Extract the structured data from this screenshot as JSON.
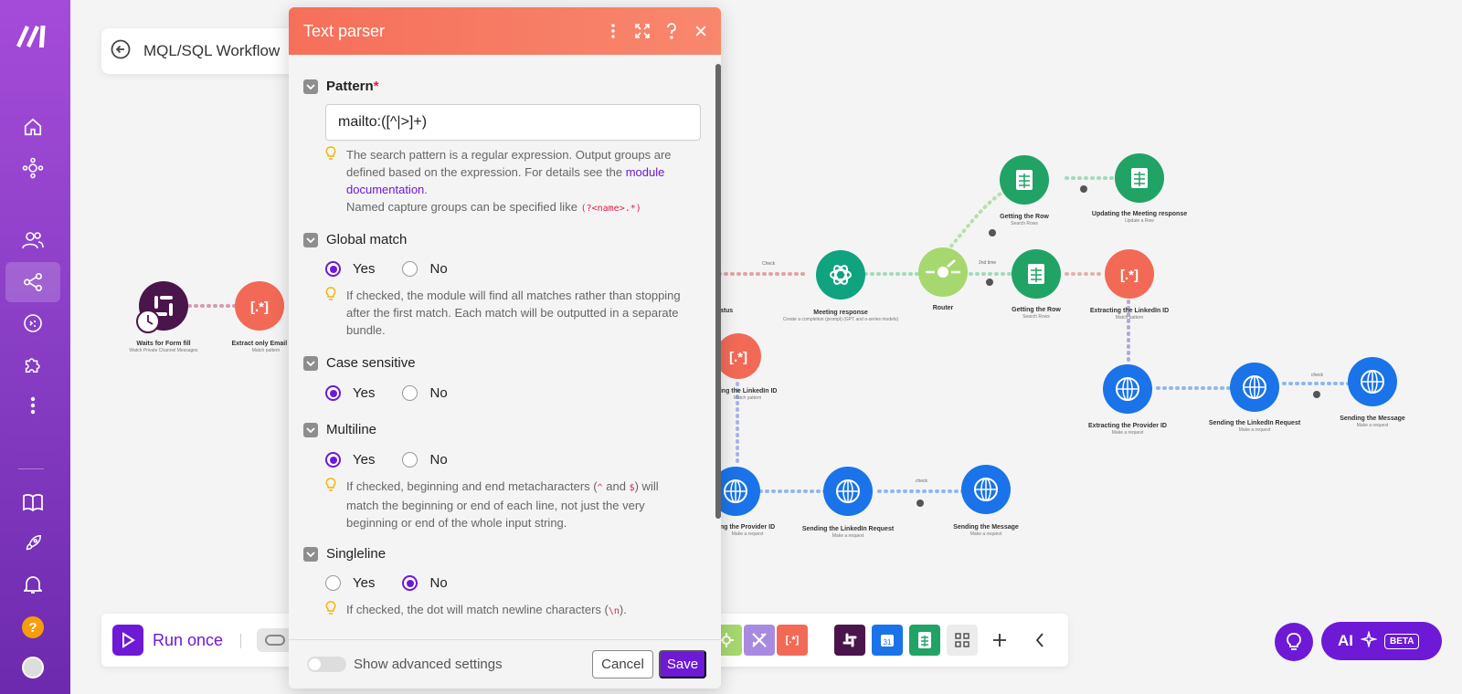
{
  "scenario": {
    "title": "MQL/SQL Workflow"
  },
  "flow_nodes": [
    {
      "id": "slack",
      "label": "Waits for Form fill",
      "sub": "Watch Private Channel Messages",
      "color": "#4a154b",
      "icon": "slack-icon"
    },
    {
      "id": "textparser1",
      "label": "Extract only Email add",
      "sub": "Match pattern",
      "color": "#f26a56",
      "icon": "text-parser-icon"
    },
    {
      "id": "status",
      "label": "atus",
      "sub": ""
    },
    {
      "id": "openai",
      "label": "Meeting response",
      "sub": "Create a completion (prompt) (GPT and o-series models)",
      "color": "#10a37f",
      "icon": "openai-icon"
    },
    {
      "id": "router",
      "label": "Router",
      "sub": "",
      "color": "#a6d86f",
      "icon": "router-icon"
    },
    {
      "id": "sheets_get1",
      "label": "Getting the Row",
      "sub": "Search Rows",
      "color": "#21a366",
      "icon": "sheets-icon"
    },
    {
      "id": "sheets_update",
      "label": "Updating the Meeting response",
      "sub": "Update a Row",
      "color": "#21a366",
      "icon": "sheets-icon"
    },
    {
      "id": "sheets_get2",
      "label": "Getting the Row",
      "sub": "Search Rows",
      "color": "#21a366",
      "icon": "sheets-icon"
    },
    {
      "id": "textparser2",
      "label": "Extracting the LinkedIn ID",
      "sub": "Match pattern",
      "color": "#f26a56",
      "icon": "text-parser-icon"
    },
    {
      "id": "http1",
      "label": "Extracting the Provider ID",
      "sub": "Make a request",
      "color": "#1a73e8",
      "icon": "globe-icon"
    },
    {
      "id": "http2",
      "label": "Sending the LinkedIn Request",
      "sub": "Make a request",
      "color": "#1a73e8",
      "icon": "globe-icon"
    },
    {
      "id": "http3",
      "label": "Sending the Message",
      "sub": "Make a request",
      "color": "#1a73e8",
      "icon": "globe-icon"
    },
    {
      "id": "textparser3",
      "label": "ting the LinkedIn ID",
      "sub": "Match pattern",
      "color": "#f26a56",
      "icon": "text-parser-icon"
    },
    {
      "id": "http4",
      "label": "ng the Provider ID",
      "sub": "Make a request",
      "color": "#1a73e8",
      "icon": "globe-icon"
    },
    {
      "id": "http5",
      "label": "Sending the LinkedIn Request",
      "sub": "Make a request",
      "color": "#1a73e8",
      "icon": "globe-icon"
    },
    {
      "id": "http6",
      "label": "Sending the Message",
      "sub": "Make a request",
      "color": "#1a73e8",
      "icon": "globe-icon"
    }
  ],
  "flow_link_labels": {
    "check": "Check",
    "second_time": "2nd time",
    "check2": "check",
    "check3": "check"
  },
  "modal": {
    "title": "Text parser",
    "pattern": {
      "label": "Pattern",
      "required_mark": "*",
      "value": "mailto:([^|>]+)",
      "hint_1": "The search pattern is a regular expression. Output groups are defined based on the expression. For details see the",
      "hint_link": "module documentation",
      "hint_end": ".",
      "hint_2": "Named capture groups can be specified like",
      "hint_code": "(?<name>.*)"
    },
    "global_match": {
      "label": "Global match",
      "yes": "Yes",
      "no": "No",
      "selected": "Yes",
      "hint": "If checked, the module will find all matches rather than stopping after the first match. Each match will be outputted in a separate bundle."
    },
    "case_sensitive": {
      "label": "Case sensitive",
      "yes": "Yes",
      "no": "No",
      "selected": "Yes"
    },
    "multiline": {
      "label": "Multiline",
      "yes": "Yes",
      "no": "No",
      "selected": "Yes",
      "hint_a": "If checked, beginning and end metacharacters (",
      "code_a": "^",
      "hint_b": " and ",
      "code_b": "$",
      "hint_c": ") will match the beginning or end of each line, not just the very beginning or end of the whole input string."
    },
    "singleline": {
      "label": "Singleline",
      "yes": "Yes",
      "no": "No",
      "selected": "No",
      "hint_a": "If checked, the dot will match newline characters (",
      "code": "\\n",
      "hint_b": ")."
    },
    "advanced_label": "Show advanced settings",
    "cancel": "Cancel",
    "save": "Save"
  },
  "toolbar": {
    "run_once": "Run once"
  },
  "ai": {
    "label": "AI",
    "beta": "BETA"
  },
  "colors": {
    "accent": "#6d19d6",
    "rail": "#8b3fc7",
    "header": "#f66f5a",
    "http": "#1a73e8",
    "sheets": "#21a366",
    "parser": "#f26a56"
  }
}
